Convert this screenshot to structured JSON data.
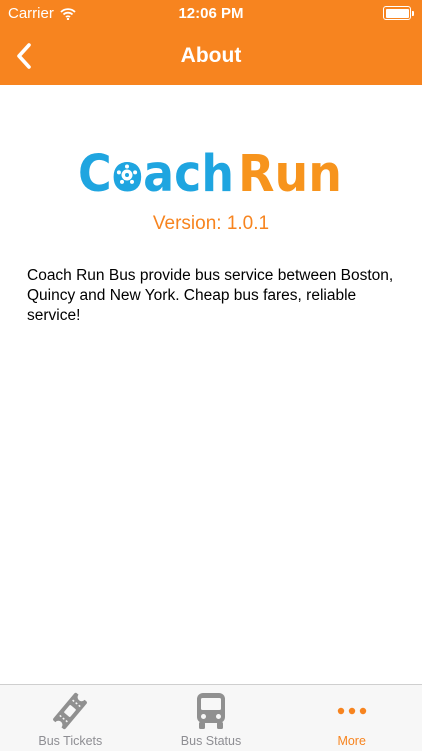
{
  "status_bar": {
    "carrier": "Carrier",
    "time": "12:06 PM"
  },
  "nav": {
    "title": "About",
    "back_icon": "chevron-left-icon"
  },
  "logo": {
    "text_part1": "Coach",
    "text_part2": "Run",
    "icon": "wheel-icon"
  },
  "version": "Version: 1.0.1",
  "description": "Coach Run Bus provide bus service between Boston, Quincy and New York. Cheap bus fares, reliable service!",
  "tabs": [
    {
      "label": "Bus Tickets",
      "icon": "ticket-icon",
      "active": false
    },
    {
      "label": "Bus Status",
      "icon": "bus-icon",
      "active": false
    },
    {
      "label": "More",
      "icon": "more-icon",
      "active": true
    }
  ],
  "colors": {
    "accent": "#f7841f",
    "logo_blue": "#1fa5e0",
    "logo_orange": "#f7941d",
    "tab_inactive": "#8e8e93"
  }
}
